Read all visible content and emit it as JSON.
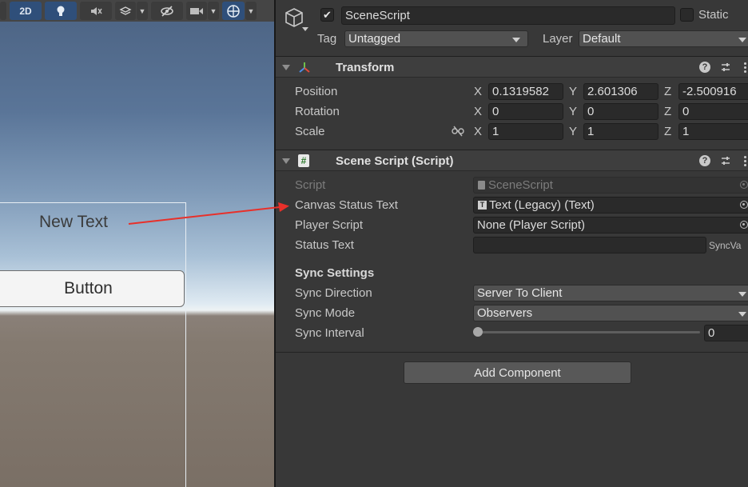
{
  "scene": {
    "toolbar": {
      "mode_2d": "2D"
    },
    "new_text": "New Text",
    "button_label": "Button"
  },
  "inspector": {
    "object_name": "SceneScript",
    "active_checked": true,
    "static_label": "Static",
    "tag_label": "Tag",
    "tag_value": "Untagged",
    "layer_label": "Layer",
    "layer_value": "Default",
    "transform": {
      "title": "Transform",
      "position_label": "Position",
      "rotation_label": "Rotation",
      "scale_label": "Scale",
      "axis_x": "X",
      "axis_y": "Y",
      "axis_z": "Z",
      "position": {
        "x": "0.1319582",
        "y": "2.601306",
        "z": "-2.500916"
      },
      "rotation": {
        "x": "0",
        "y": "0",
        "z": "0"
      },
      "scale": {
        "x": "1",
        "y": "1",
        "z": "1"
      }
    },
    "script_component": {
      "title": "Scene Script (Script)",
      "script_label": "Script",
      "script_value": "SceneScript",
      "canvas_status_label": "Canvas Status Text",
      "canvas_status_value": "Text (Legacy) (Text)",
      "player_script_label": "Player Script",
      "player_script_value": "None (Player Script)",
      "status_text_label": "Status Text",
      "status_text_value": "",
      "syncvar_tag": "SyncVa",
      "sync_settings_header": "Sync Settings",
      "sync_direction_label": "Sync Direction",
      "sync_direction_value": "Server To Client",
      "sync_mode_label": "Sync Mode",
      "sync_mode_value": "Observers",
      "sync_interval_label": "Sync Interval",
      "sync_interval_value": "0",
      "sync_interval_level": 0
    },
    "add_component_label": "Add Component"
  },
  "colors": {
    "arrow": "#e8302a",
    "toolbar_active": "#2f4f7a",
    "inspector_bg": "#383838",
    "field_bg": "#2a2a2a"
  }
}
